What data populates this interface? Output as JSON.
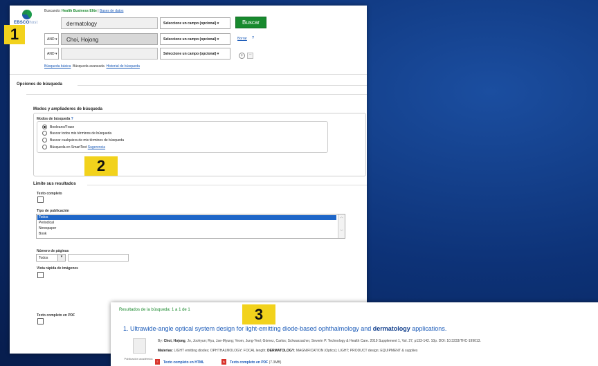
{
  "logo": {
    "name": "EBSCO",
    "suffix": "host"
  },
  "search": {
    "searching_label": "Buscando:",
    "database": "Health Business Elite",
    "database_link": "Bases de datos",
    "row1": {
      "value": "dermatology",
      "field": "Seleccione un campo (opcional)"
    },
    "row2": {
      "operator": "AND",
      "value": "Choi, Hojong",
      "field": "Seleccione un campo (opcional)"
    },
    "row3": {
      "operator": "AND",
      "value": "",
      "field": "Seleccione un campo (opcional)"
    },
    "search_button": "Buscar",
    "clear_link": "Borrar",
    "help_icon": "?",
    "add_row": "+",
    "remove_row": "−",
    "tabs": [
      "Búsqueda básica",
      "Búsqueda avanzada",
      "Historial de búsqueda"
    ]
  },
  "options": {
    "title": "Opciones de búsqueda",
    "modes_title": "Modos y ampliadores de búsqueda",
    "modes_label": "Modos de búsqueda",
    "modes_help": "?",
    "modes": [
      {
        "label": "Booleano/Frase",
        "checked": true
      },
      {
        "label": "Buscar todos mis términos de búsqueda",
        "checked": false
      },
      {
        "label": "Buscar cualquiera de mis términos de búsqueda",
        "checked": false
      },
      {
        "label": "Búsqueda en SmartText",
        "checked": false,
        "hint": "Sugerencia"
      }
    ]
  },
  "limits": {
    "title": "Limite sus resultados",
    "full_text": "Texto completo",
    "pub_type": "Tipo de publicación",
    "pub_types": [
      "Todos",
      "Periodical",
      "Newspaper",
      "Book"
    ],
    "pages_label": "Número de páginas",
    "pages_value": "Todos",
    "quick_image": "Vista rápida de imágenes",
    "pdf_full_text": "Texto completo en PDF"
  },
  "badges": [
    "1",
    "2",
    "3"
  ],
  "results": {
    "count": "Resultados de la búsqueda: 1 a 1 de 1",
    "item": {
      "index": "1.",
      "title_before": "Ultrawide-angle optical system design for light-emitting diode-based ophthalmology and",
      "title_bold": "dermatology",
      "title_after": "applications.",
      "by_label": "By:",
      "authors_bold": "Choi, Hojong",
      "authors_rest": ", Jo, Joohyun; Ryu, Jae-Myung; Yeom, Jung-Yeol; Gómez, Carlos; Schwarzacher, Severin P. Technology & Health Care. 2019 Supplement 1, Vol. 27, p133-142. 10p. DOI: 10.3233/THC-199013.",
      "subjects_label": "Materias:",
      "subjects": "LIGHT emitting diodes; OPHTHALMOLOGY; FOCAL length;",
      "subjects_bold": "DERMATOLOGY",
      "subjects_rest": "; MAGNIFICATION (Optics); LIGHT; PRODUCT design; EQUIPMENT & supplies",
      "doc_type": "Publicación académica",
      "html_link": "Texto completo en HTML",
      "pdf_link": "Texto completo en PDF",
      "pdf_size": "(7.3MB)"
    }
  },
  "colors": {
    "accent": "#188a2e",
    "link": "#1a5ab8",
    "badge": "#f2d21c",
    "background": "#0d3277"
  }
}
